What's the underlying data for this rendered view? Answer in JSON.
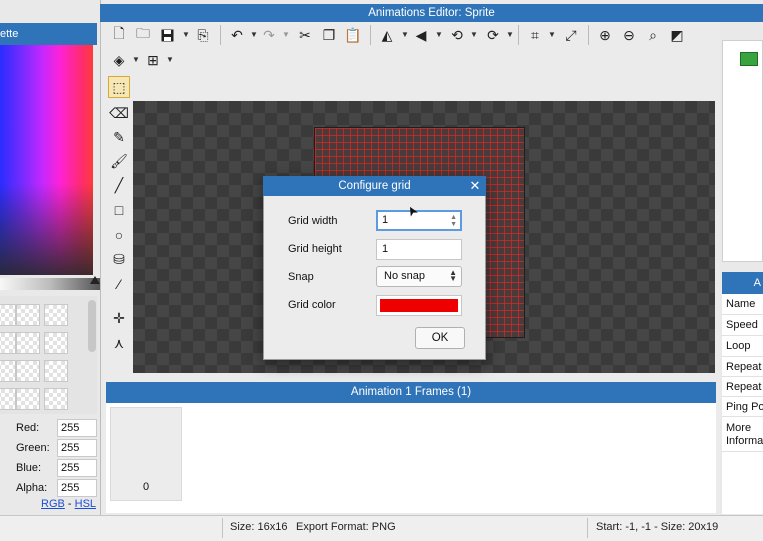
{
  "window": {
    "title": "Animations Editor: Sprite"
  },
  "palette": {
    "title_fragment": "ette",
    "components": [
      {
        "label": "Red:",
        "value": "255"
      },
      {
        "label": "Green:",
        "value": "255"
      },
      {
        "label": "Blue:",
        "value": "255"
      },
      {
        "label": "Alpha:",
        "value": "255"
      }
    ],
    "mode_links": {
      "rgb": "RGB",
      "separator": " - ",
      "hsl": "HSL"
    }
  },
  "toolbar": {
    "row1_icons": [
      "new-file-icon",
      "open-folder-icon",
      "save-icon",
      "export-icon",
      "undo-icon",
      "redo-icon",
      "cut-icon",
      "copy-icon",
      "paste-icon",
      "flip-horizontal-icon",
      "flip-vertical-icon",
      "rotate-ccw-icon",
      "rotate-cw-icon",
      "crop-icon",
      "resize-icon",
      "zoom-in-icon",
      "zoom-out-icon",
      "zoom-fit-icon",
      "zoom-reset-icon"
    ],
    "row2_icons": [
      "layers-icon",
      "grid-icon"
    ]
  },
  "tools": [
    "selection-tool-icon",
    "eraser-icon",
    "pencil-icon",
    "brush-icon",
    "line-icon",
    "rectangle-icon",
    "ellipse-icon",
    "fill-bucket-icon",
    "eyedropper-icon",
    "move-origin-icon",
    "hitbox-icon"
  ],
  "frames": {
    "header": "Animation 1 Frames (1)",
    "items": [
      {
        "index": "0"
      }
    ]
  },
  "status": {
    "size": "Size: 16x16",
    "export": "Export Format: PNG",
    "selection": "Start: -1, -1 - Size: 20x19"
  },
  "right_panel": {
    "header_fragment": "A",
    "properties": [
      "Name",
      "Speed",
      "Loop",
      "Repeat",
      "Repeat",
      "Ping Po",
      "More Informa"
    ]
  },
  "dialog": {
    "title": "Configure grid",
    "close_glyph": "✕",
    "grid_width_label": "Grid width",
    "grid_width_value": "1",
    "grid_height_label": "Grid height",
    "grid_height_value": "1",
    "snap_label": "Snap",
    "snap_value": "No snap",
    "grid_color_label": "Grid color",
    "grid_color_hex": "#ee0000",
    "ok_label": "OK"
  }
}
